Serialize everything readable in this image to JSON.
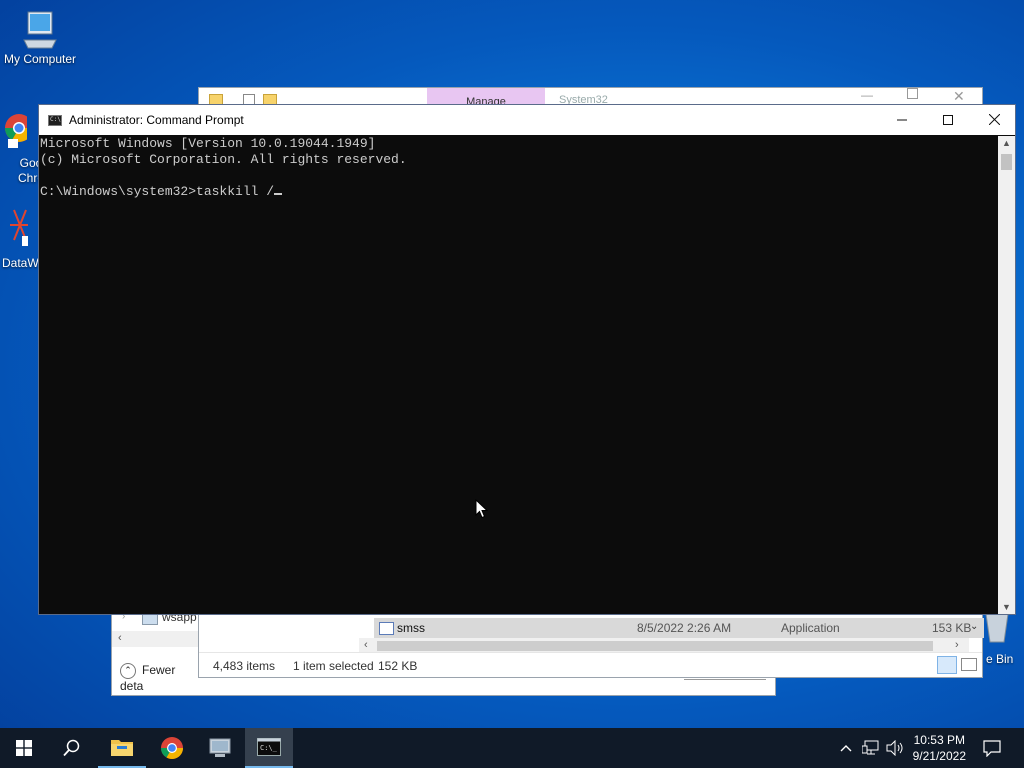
{
  "desktop": {
    "icons": [
      {
        "label": "My Computer"
      },
      {
        "label": "Goo\nChro"
      },
      {
        "label": "DataW"
      },
      {
        "label": "e Bin"
      }
    ]
  },
  "explorer_back": {
    "status_left": "Fewer deta",
    "tree_item": "wsapp"
  },
  "explorer_front": {
    "title": "System32",
    "ribbon_tab": "Manage",
    "row": {
      "name": "smss",
      "date": "8/5/2022 2:26 AM",
      "type": "Application",
      "size": "153 KB"
    },
    "status": {
      "items": "4,483 items",
      "selected": "1 item selected",
      "size": "152 KB"
    }
  },
  "cmd": {
    "title": "Administrator: Command Prompt",
    "lines": [
      "Microsoft Windows [Version 10.0.19044.1949]",
      "(c) Microsoft Corporation. All rights reserved.",
      "",
      "C:\\Windows\\system32>taskkill /"
    ]
  },
  "taskbar": {
    "time": "10:53 PM",
    "date": "9/21/2022"
  },
  "colors": {
    "accent": "#0a78d8",
    "console_bg": "#0c0c0c",
    "console_fg": "#cccccc",
    "taskbar": "#101a28"
  }
}
